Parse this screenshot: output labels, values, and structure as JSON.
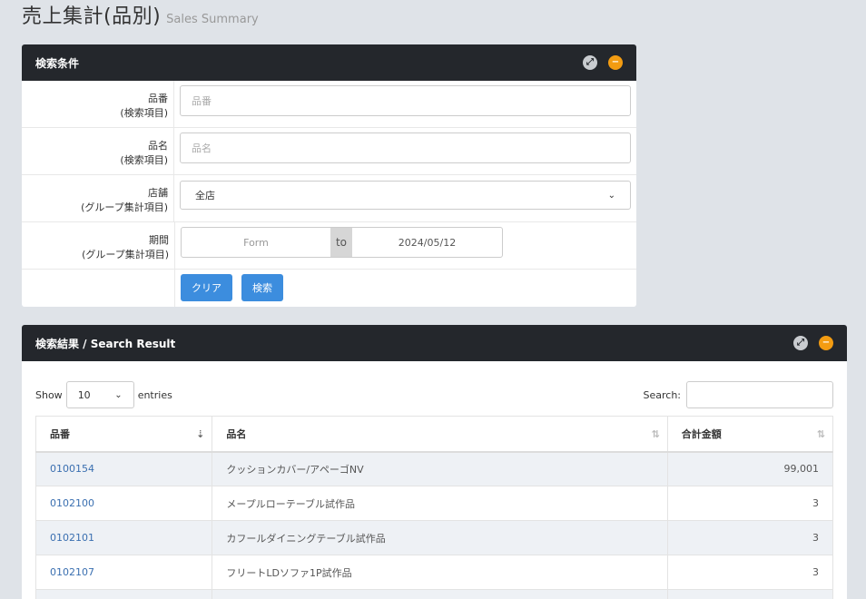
{
  "page": {
    "title": "売上集計(品別)",
    "subtitle": "Sales Summary"
  },
  "search_panel": {
    "title": "検索条件",
    "fields": [
      {
        "label": "品番",
        "sublabel": "(検索項目)",
        "placeholder": "品番",
        "value": ""
      },
      {
        "label": "品名",
        "sublabel": "(検索項目)",
        "placeholder": "品名",
        "value": ""
      },
      {
        "label": "店舗",
        "sublabel": "(グループ集計項目)",
        "selected": "全店"
      },
      {
        "label": "期間",
        "sublabel": "(グループ集計項目)",
        "from_placeholder": "Form",
        "to_label": "to",
        "to_value": "2024/05/12"
      }
    ],
    "clear_label": "クリア",
    "search_label": "検索"
  },
  "result_panel": {
    "title": "検索結果 / Search Result",
    "show_label": "Show",
    "entries_value": "10",
    "entries_label": "entries",
    "search_label": "Search:",
    "columns": [
      "品番",
      "品名",
      "合計金額"
    ],
    "rows": [
      {
        "code": "0100154",
        "name": "クッションカバー/アペーゴNV",
        "amount": "99,001"
      },
      {
        "code": "0102100",
        "name": "メープルローテーブル試作品",
        "amount": "3"
      },
      {
        "code": "0102101",
        "name": "カフールダイニングテーブル試作品",
        "amount": "3"
      },
      {
        "code": "0102107",
        "name": "フリートLDソファ1P試作品",
        "amount": "3"
      }
    ]
  },
  "colors": {
    "header_bg": "#24272c",
    "accent": "#3c8dde",
    "collapse": "#f39c12",
    "link": "#3a6fb0"
  }
}
